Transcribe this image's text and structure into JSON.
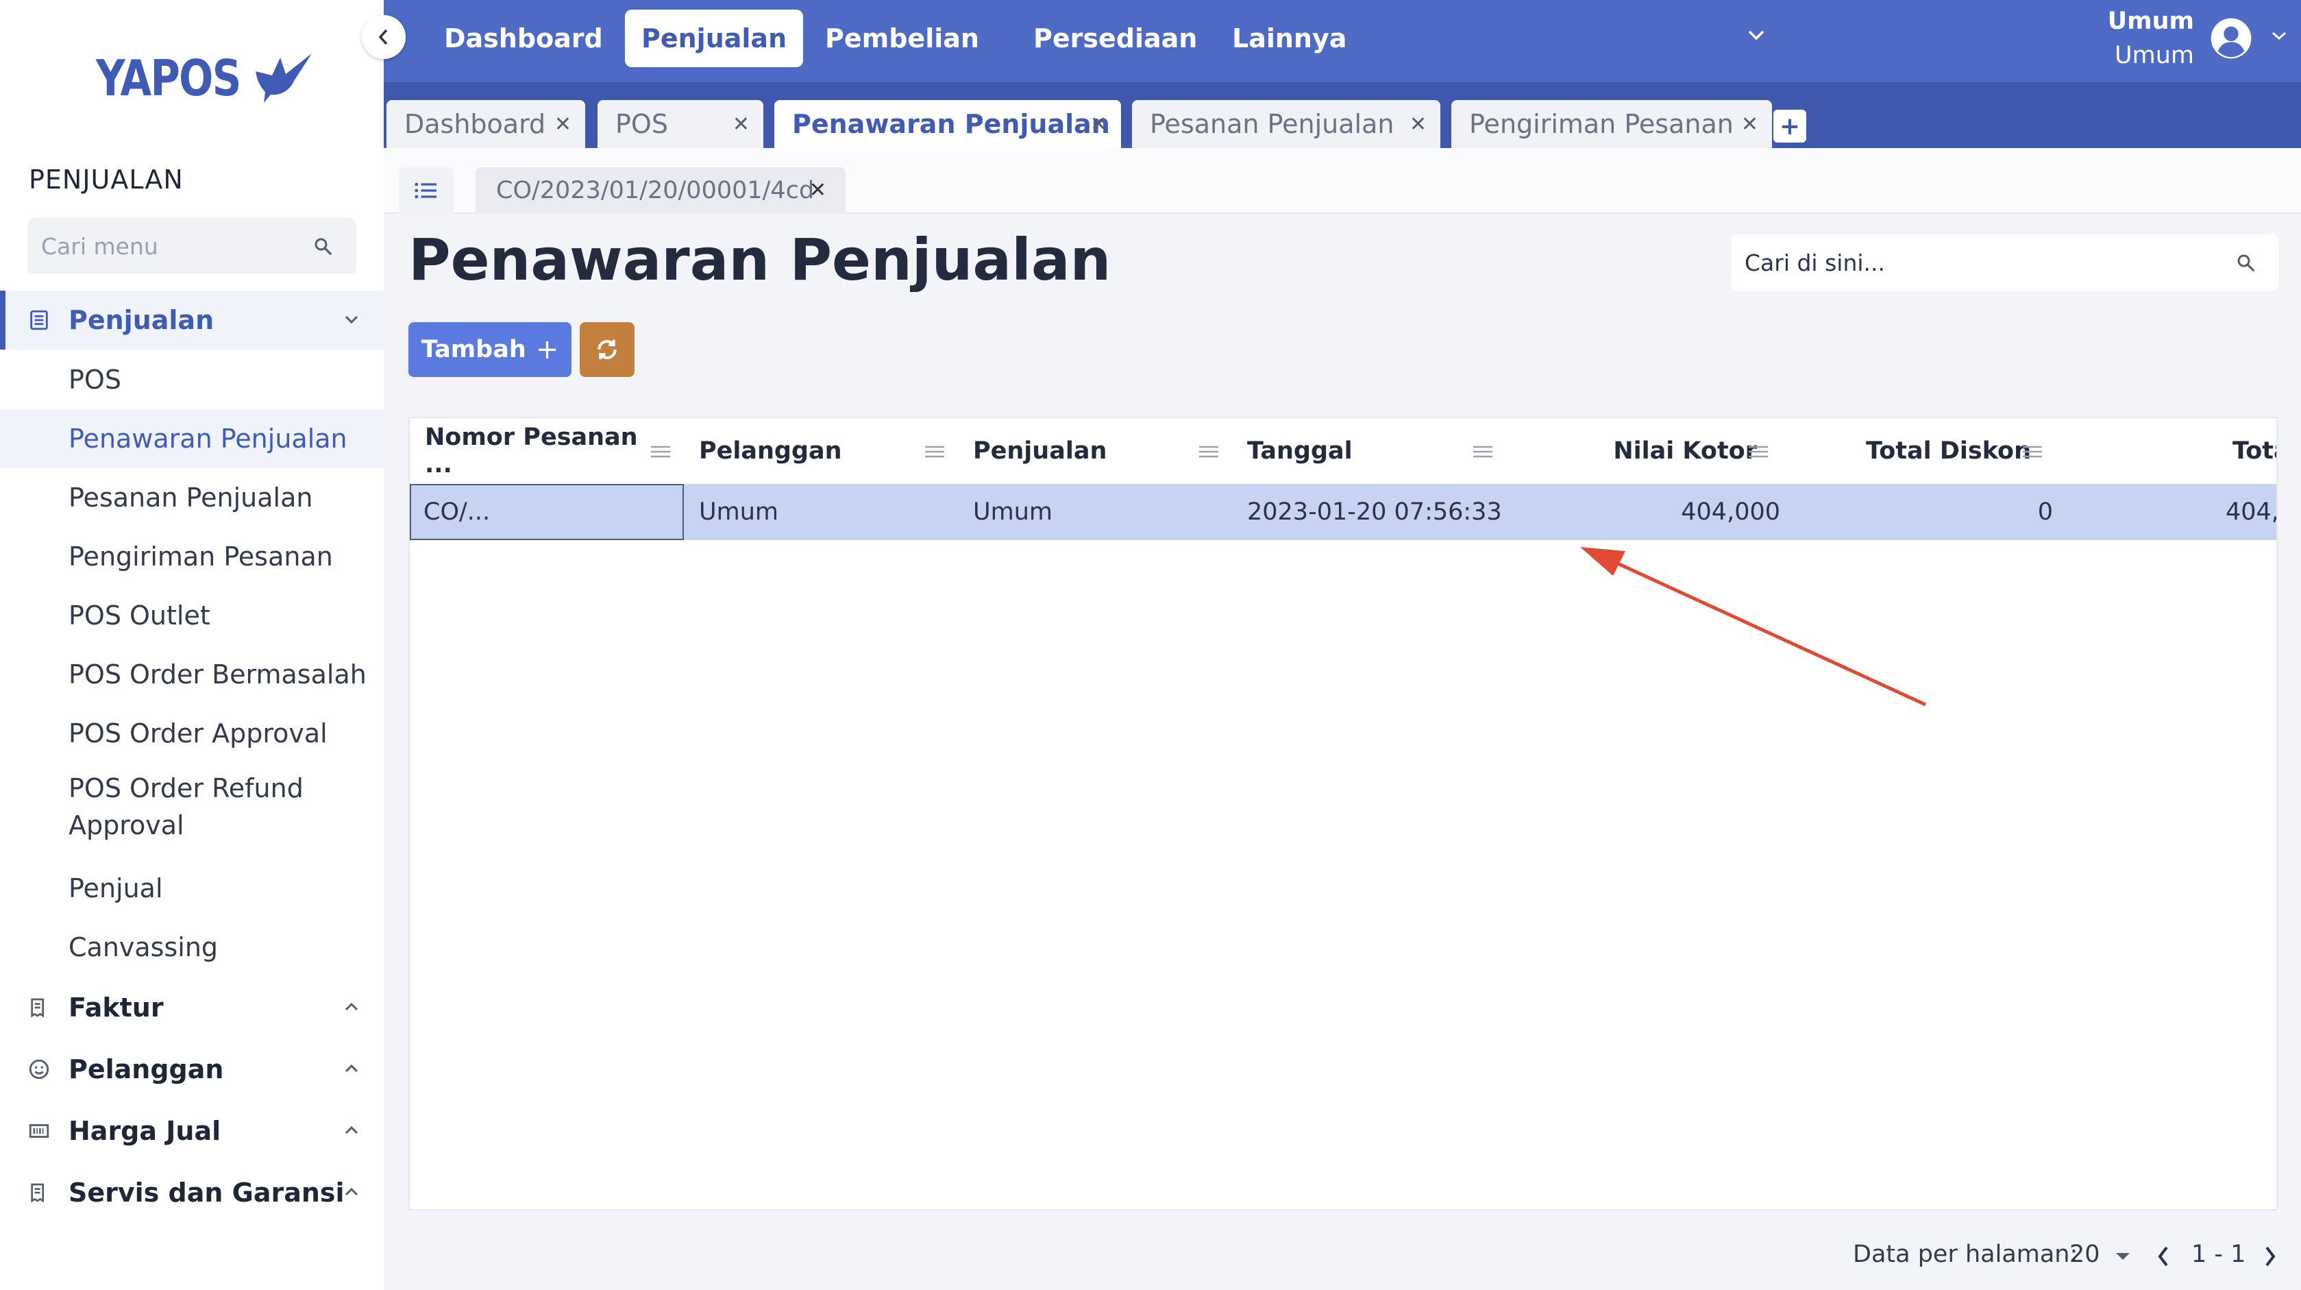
{
  "sidebar": {
    "logo_text": "YAPOS",
    "section_title": "PENJUALAN",
    "search_placeholder": "Cari menu",
    "active_group": "Penjualan",
    "items": [
      "POS",
      "Penawaran Penjualan",
      "Pesanan Penjualan",
      "Pengiriman Pesanan",
      "POS Outlet",
      "POS Order Bermasalah",
      "POS Order Approval",
      "POS Order Refund Approval",
      "Penjual",
      "Canvassing"
    ],
    "groups": [
      "Faktur",
      "Pelanggan",
      "Harga Jual",
      "Servis dan Garansi"
    ]
  },
  "topbar": {
    "nav": [
      "Dashboard",
      "Penjualan",
      "Pembelian",
      "Persediaan",
      "Lainnya"
    ],
    "active_nav": "Penjualan",
    "user_line1": "Umum",
    "user_line2": "Umum"
  },
  "tabs": [
    "Dashboard",
    "POS",
    "Penawaran Penjualan",
    "Pesanan Penjualan",
    "Pengiriman Pesanan"
  ],
  "active_tab": "Penawaran Penjualan",
  "doc_tab": "CO/2023/01/20/00001/4cd",
  "page": {
    "title": "Penawaran Penjualan",
    "search_placeholder": "Cari di sini...",
    "add_label": "Tambah"
  },
  "grid": {
    "columns": [
      "Nomor Pesanan ...",
      "Pelanggan",
      "Penjualan",
      "Tanggal",
      "Nilai Kotor",
      "Total Diskon",
      "Tota"
    ],
    "rows": [
      [
        "CO/...",
        "Umum",
        "Umum",
        "2023-01-20 07:56:33",
        "404,000",
        "0",
        "404,("
      ]
    ]
  },
  "pager": {
    "label": "Data per halaman:",
    "page_size": "20",
    "range": "1 - 1"
  },
  "colors": {
    "brand": "#4f6ac4",
    "tabbar": "#3f58ad",
    "primary_button": "#5b7ae0",
    "refresh_button": "#c4803f",
    "selected_row": "#c8d2f3",
    "annotation_arrow": "#e04a33"
  }
}
